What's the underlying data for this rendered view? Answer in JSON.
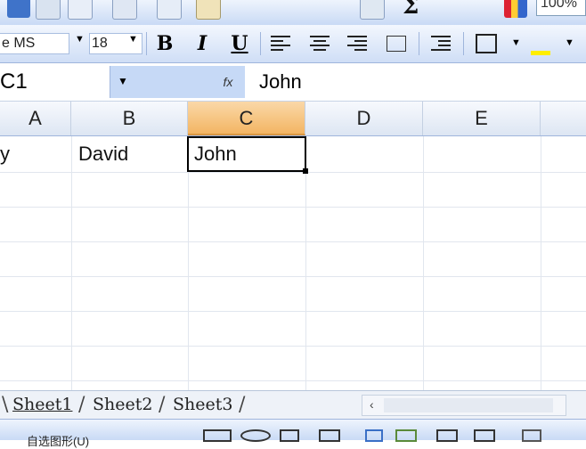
{
  "toolbar": {
    "zoom": "100%",
    "sum_symbol": "Σ"
  },
  "format_toolbar": {
    "font_name": "e MS",
    "font_size": "18",
    "bold_label": "B",
    "italic_label": "I",
    "underline_label": "U"
  },
  "formula_bar": {
    "name_box": "C1",
    "fx_label": "fx",
    "content": "John"
  },
  "columns": [
    "A",
    "B",
    "C",
    "D",
    "E"
  ],
  "active_column": "C",
  "cells": {
    "A1": "y",
    "B1": "David",
    "C1": "John"
  },
  "sheet_tabs": [
    "Sheet1",
    "Sheet2",
    "Sheet3"
  ],
  "active_sheet": "Sheet1",
  "drawing_toolbar": {
    "autoshapes_label": "自选图形(U)"
  },
  "colors": {
    "toolbar_bg": "#c9daf5",
    "active_header": "#f3b563",
    "grid_line": "#e1e6ee"
  }
}
